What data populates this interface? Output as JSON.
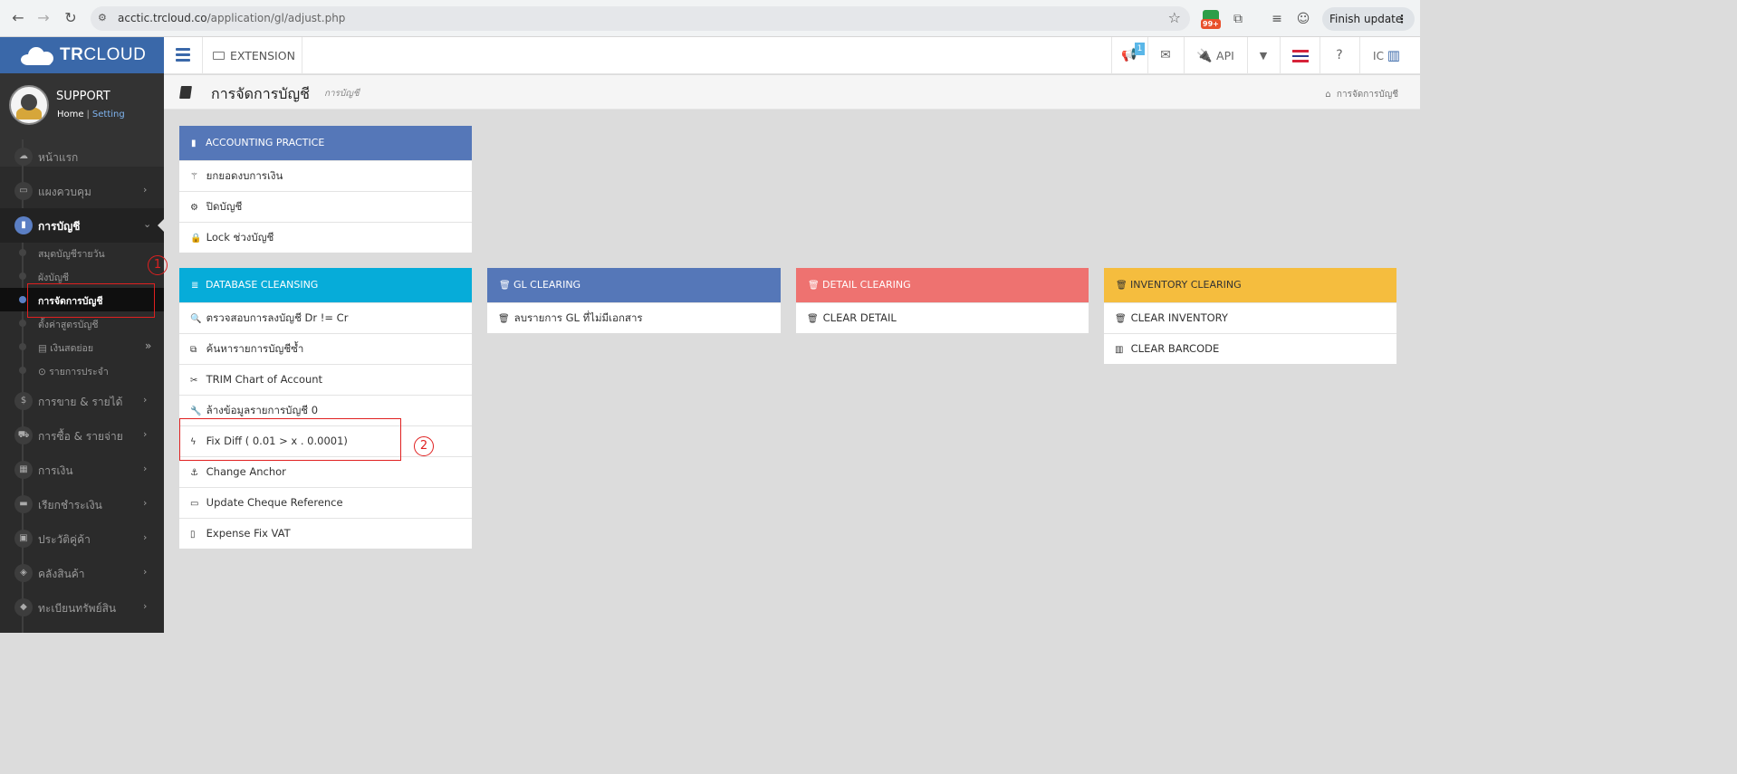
{
  "browser": {
    "url_host": "acctic.trcloud.co",
    "url_path": "/application/gl/adjust.php",
    "ext_badge_count": "99+",
    "finish_update": "Finish update"
  },
  "brand": {
    "logo_bold": "TR",
    "logo_rest": "CLOUD"
  },
  "profile": {
    "name": "SUPPORT",
    "home": "Home",
    "setting": "Setting"
  },
  "sidebar": {
    "items": [
      {
        "label": "หน้าแรก",
        "icon": "cloud-icon"
      },
      {
        "label": "แผงควบคุม",
        "icon": "monitor-icon"
      },
      {
        "label": "การบัญชี",
        "icon": "book-icon"
      },
      {
        "label": "การขาย & รายได้",
        "icon": "dollar-icon"
      },
      {
        "label": "การซื้อ & รายจ่าย",
        "icon": "cart-icon"
      },
      {
        "label": "การเงิน",
        "icon": "calendar-icon"
      },
      {
        "label": "เรียกชำระเงิน",
        "icon": "card-icon"
      },
      {
        "label": "ประวัติคู่ค้า",
        "icon": "contact-icon"
      },
      {
        "label": "คลังสินค้า",
        "icon": "cubes-icon"
      },
      {
        "label": "ทะเบียนทรัพย์สิน",
        "icon": "diamond-icon"
      }
    ],
    "accounting_sub": [
      {
        "label": "สมุดบัญชีรายวัน"
      },
      {
        "label": "ผังบัญชี"
      },
      {
        "label": "การจัดการบัญชี"
      },
      {
        "label": "ตั้งค่าสูตรบัญชี"
      },
      {
        "label": "เงินสดย่อย"
      },
      {
        "label": "รายการประจำ"
      }
    ]
  },
  "topbar": {
    "extension": "EXTENSION",
    "notif_badge": "1",
    "api": "API",
    "company_code": "IC"
  },
  "page": {
    "title": "การจัดการบัญชี",
    "subtitle": "การบัญชี",
    "breadcrumb": "การจัดการบัญชี"
  },
  "panels": {
    "accounting_practice": {
      "header": "ACCOUNTING PRACTICE",
      "rows": [
        {
          "label": "ยกยอดงบการเงิน",
          "icon": "magic-wand-icon"
        },
        {
          "label": "ปิดบัญชี",
          "icon": "gear-icon"
        },
        {
          "label": "Lock ช่วงบัญชี",
          "icon": "lock-icon"
        }
      ]
    },
    "database_cleansing": {
      "header": "DATABASE CLEANSING",
      "rows": [
        {
          "label": "ตรวจสอบการลงบัญชี Dr != Cr",
          "icon": "search-icon"
        },
        {
          "label": "ค้นหารายการบัญชีซ้ำ",
          "icon": "copy-icon"
        },
        {
          "label": "TRIM Chart of Account",
          "icon": "scissors-icon"
        },
        {
          "label": "ล้างข้อมูลรายการบัญชี 0",
          "icon": "wrench-icon"
        },
        {
          "label": "Fix Diff ( 0.01 > x . 0.0001)",
          "icon": "bolt-icon"
        },
        {
          "label": "Change Anchor",
          "icon": "anchor-icon"
        },
        {
          "label": "Update Cheque Reference",
          "icon": "credit-card-icon"
        },
        {
          "label": "Expense Fix VAT",
          "icon": "file-icon"
        }
      ]
    },
    "gl_clearing": {
      "header": "GL CLEARING",
      "rows": [
        {
          "label": "ลบรายการ GL ที่ไม่มีเอกสาร",
          "icon": "trash-icon"
        }
      ]
    },
    "detail_clearing": {
      "header": "DETAIL CLEARING",
      "rows": [
        {
          "label": "CLEAR DETAIL",
          "icon": "trash-icon"
        }
      ]
    },
    "inventory_clearing": {
      "header": "INVENTORY CLEARING",
      "rows": [
        {
          "label": "CLEAR INVENTORY",
          "icon": "trash-icon"
        },
        {
          "label": "CLEAR BARCODE",
          "icon": "barcode-icon"
        }
      ]
    }
  },
  "annotations": {
    "step1": "1",
    "step2": "2"
  },
  "colors": {
    "brand_blue": "#3a68a9",
    "panel_blue": "#5577b8",
    "panel_cyan": "#06acd9",
    "panel_red": "#ee7270",
    "panel_yellow": "#f5bd3e",
    "annotation_red": "#e02020"
  }
}
